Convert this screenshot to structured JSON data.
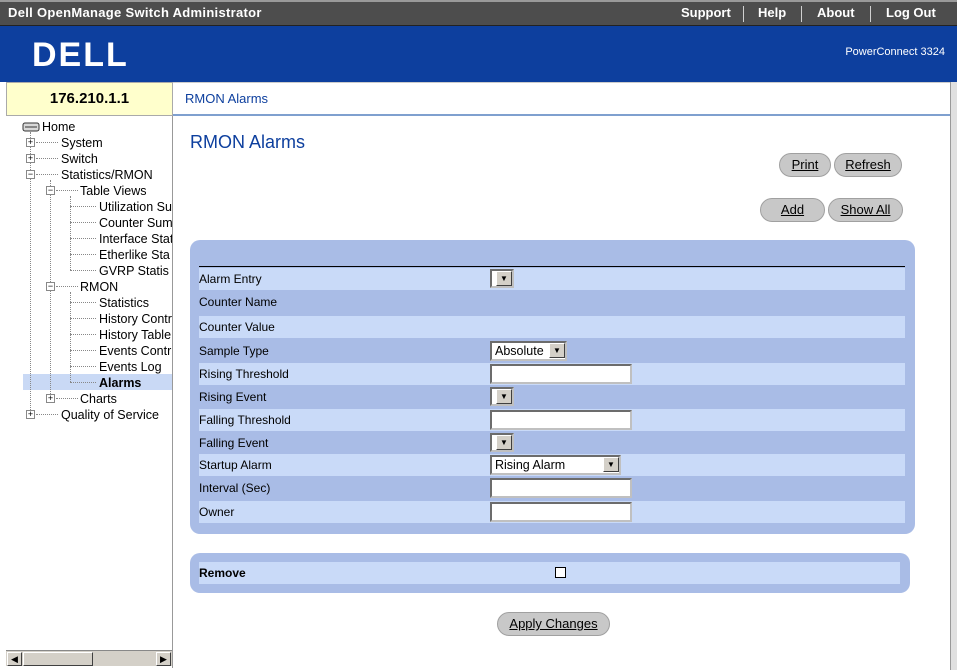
{
  "window": {
    "title": "Dell OpenManage Switch Administrator",
    "links": [
      "Support",
      "Help",
      "About",
      "Log Out"
    ]
  },
  "header": {
    "logo": "DELL",
    "model": "PowerConnect 3324",
    "brand_color": "#0d3f9e"
  },
  "ip_address": "176.210.1.1",
  "breadcrumb": "RMON Alarms",
  "nav": {
    "home": "Home",
    "system": "System",
    "switch": "Switch",
    "stats": "Statistics/RMON",
    "table_views": "Table Views",
    "utilization": "Utilization Su",
    "counter": "Counter Sum",
    "interface": "Interface Stat",
    "etherlike": "Etherlike Sta",
    "gvrp": "GVRP Statis",
    "rmon": "RMON",
    "statistics": "Statistics",
    "history_control": "History Contr",
    "history_table": "History Table",
    "events_control": "Events Contr",
    "events_log": "Events Log",
    "alarms": "Alarms",
    "charts": "Charts",
    "qos": "Quality of Service"
  },
  "page": {
    "title": "RMON Alarms",
    "print": "Print",
    "refresh": "Refresh",
    "add": "Add",
    "show_all": "Show All",
    "apply": "Apply Changes"
  },
  "form": {
    "alarm_entry": "Alarm Entry",
    "counter_name": "Counter Name",
    "counter_value": "Counter Value",
    "sample_type": "Sample Type",
    "sample_type_value": "Absolute",
    "rising_threshold": "Rising Threshold",
    "rising_event": "Rising Event",
    "falling_threshold": "Falling Threshold",
    "falling_event": "Falling Event",
    "startup_alarm": "Startup Alarm",
    "startup_alarm_value": "Rising Alarm",
    "interval": "Interval (Sec)",
    "owner": "Owner"
  },
  "remove": {
    "label": "Remove",
    "checked": false
  }
}
